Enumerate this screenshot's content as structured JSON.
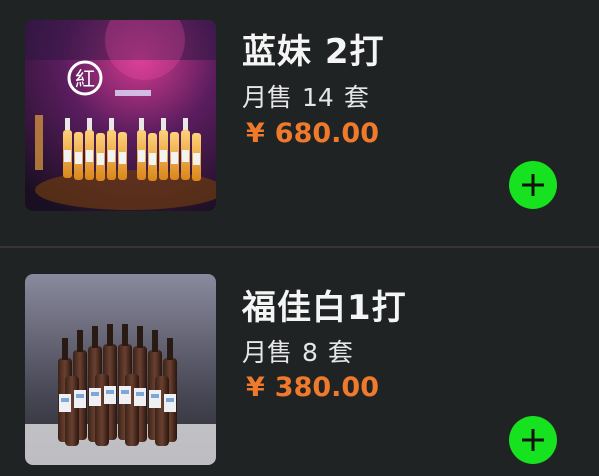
{
  "products": [
    {
      "name": "蓝妹 2打",
      "sales_label": "月售",
      "sales_count": "14",
      "sales_unit": "套",
      "currency": "¥",
      "price": "680.00",
      "image_icon": "beer-bottles-bar-photo",
      "sign_text": "紅"
    },
    {
      "name": "福佳白1打",
      "sales_label": "月售",
      "sales_count": "8",
      "sales_unit": "套",
      "currency": "¥",
      "price": "380.00",
      "image_icon": "beer-bottles-photo"
    }
  ],
  "add_button_icon": "plus-icon",
  "colors": {
    "background": "#202324",
    "price": "#f07a2c",
    "add_button": "#16e21f",
    "title": "#f5f5f5"
  }
}
